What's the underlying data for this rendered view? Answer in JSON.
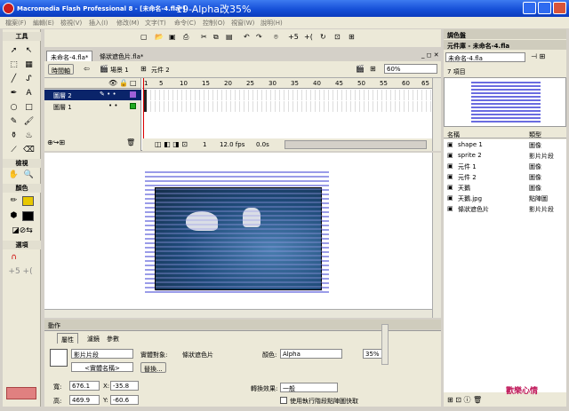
{
  "window": {
    "title": "Macromedia Flash Professional 8 - [未命名-4.fla*]",
    "overlay_title": "19-Alpha改35%"
  },
  "menu": [
    "檔案(F)",
    "編輯(E)",
    "檢視(V)",
    "插入(I)",
    "修改(M)",
    "文字(T)",
    "命令(C)",
    "控制(O)",
    "視窗(W)",
    "說明(H)"
  ],
  "tools": {
    "header": "工具",
    "view_header": "檢視",
    "color_header": "顏色",
    "options_header": "選項"
  },
  "doc_tabs": [
    "未命名-4.fla*",
    "條狀遮色片.fla*"
  ],
  "scene": {
    "timeline_btn": "時間軸",
    "scene_label": "場景 1",
    "symbol_label": "元件 2",
    "zoom": "60%"
  },
  "layers": [
    {
      "name": "圖層 2"
    },
    {
      "name": "圖層 1"
    }
  ],
  "ruler": [
    "1",
    "5",
    "10",
    "15",
    "20",
    "25",
    "30",
    "35",
    "40",
    "45",
    "50",
    "55",
    "60",
    "65"
  ],
  "timeline_status": {
    "frame": "1",
    "fps": "12.0 fps",
    "time": "0.0s"
  },
  "props": {
    "section_actions": "動作",
    "tabs": [
      "屬性",
      "濾鏡",
      "參數"
    ],
    "symbol_type": "影片片段",
    "instance_name_placeholder": "<實體名稱>",
    "instance_of_label": "實體對象:",
    "instance_of": "條狀遮色片",
    "swap_btn": "替換...",
    "color_label": "顏色:",
    "color_value": "Alpha",
    "alpha_value": "35%",
    "w_label": "寬:",
    "w_value": "676.1",
    "x_label": "X:",
    "x_value": "-35.8",
    "h_label": "高:",
    "h_value": "469.9",
    "y_label": "Y:",
    "y_value": "-60.6",
    "blend_label": "轉換效果:",
    "blend_value": "一般",
    "cache_label": "使用執行階段點陣圖快取"
  },
  "right": {
    "color_panel": "調色盤",
    "library_title": "元件庫 - 未命名-4.fla",
    "library_select": "未命名-4.fla",
    "item_count": "7 項目",
    "col_name": "名稱",
    "col_type": "類型",
    "items": [
      {
        "name": "shape 1",
        "type": "圖像"
      },
      {
        "name": "sprite 2",
        "type": "影片片段"
      },
      {
        "name": "元件 1",
        "type": "圖像"
      },
      {
        "name": "元件 2",
        "type": "圖像"
      },
      {
        "name": "天鵝",
        "type": "圖像"
      },
      {
        "name": "天鵝.jpg",
        "type": "點陣圖"
      },
      {
        "name": "條狀遮色片",
        "type": "影片片段"
      }
    ]
  },
  "watermark": "歡樂心情",
  "colors": {
    "accent": "#1650d8",
    "stripe": "#9a9ce8",
    "water": "#2c5e8a"
  }
}
